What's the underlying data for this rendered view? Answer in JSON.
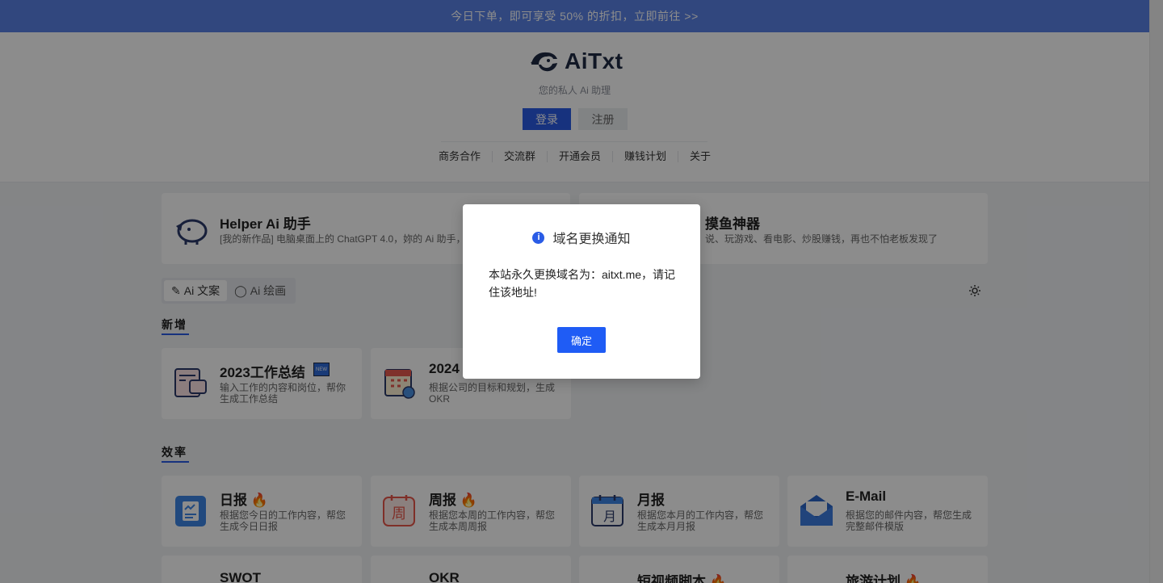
{
  "banner": {
    "text": "今日下单，即可享受 50% 的折扣，立即前往 >>"
  },
  "header": {
    "logo_text": "AiTxt",
    "tagline": "您的私人 Ai 助理",
    "login_label": "登录",
    "register_label": "注册",
    "nav": [
      "商务合作",
      "交流群",
      "开通会员",
      "赚钱计划",
      "关于"
    ]
  },
  "promos": [
    {
      "title": "Helper Ai 助手",
      "desc": "[我的新作品] 电脑桌面上的 ChatGPT 4.0，妳的 Ai 助手，"
    },
    {
      "title": "摸鱼神器",
      "desc": "说、玩游戏、看电影、炒股赚钱，再也不怕老板发现了"
    }
  ],
  "tabs": [
    {
      "label": "Ai 文案",
      "icon": "document-icon"
    },
    {
      "label": "Ai 绘画",
      "icon": "palette-icon"
    }
  ],
  "sections": {
    "new": {
      "title": "新增",
      "cards": [
        {
          "title": "2023工作总结",
          "desc": "输入工作的内容和岗位，帮你生成工作总结",
          "badge": "NEW"
        },
        {
          "title": "2024",
          "desc": "根据公司的目标和规划，生成OKR"
        }
      ]
    },
    "efficiency": {
      "title": "效率",
      "cards": [
        {
          "title": "日报 🔥",
          "desc": "根据您今日的工作内容，帮您生成今日日报"
        },
        {
          "title": "周报 🔥",
          "desc": "根据您本周的工作内容，帮您生成本周周报"
        },
        {
          "title": "月报",
          "desc": "根据您本月的工作内容，帮您生成本月月报"
        },
        {
          "title": "E-Mail",
          "desc": "根据您的邮件内容，帮您生成完整邮件模版"
        }
      ],
      "cards_row2": [
        {
          "title": "SWOT"
        },
        {
          "title": "OKR"
        },
        {
          "title": "短视频脚本 🔥"
        },
        {
          "title": "旅游计划 🔥"
        }
      ]
    }
  },
  "dialog": {
    "title": "域名更换通知",
    "body": "本站永久更换域名为：aitxt.me，请记住该地址!",
    "ok_label": "确定"
  },
  "colors": {
    "accent": "#2a5ce6",
    "banner": "#5a81e6",
    "overlay": "rgba(0,0,0,0.45)"
  }
}
